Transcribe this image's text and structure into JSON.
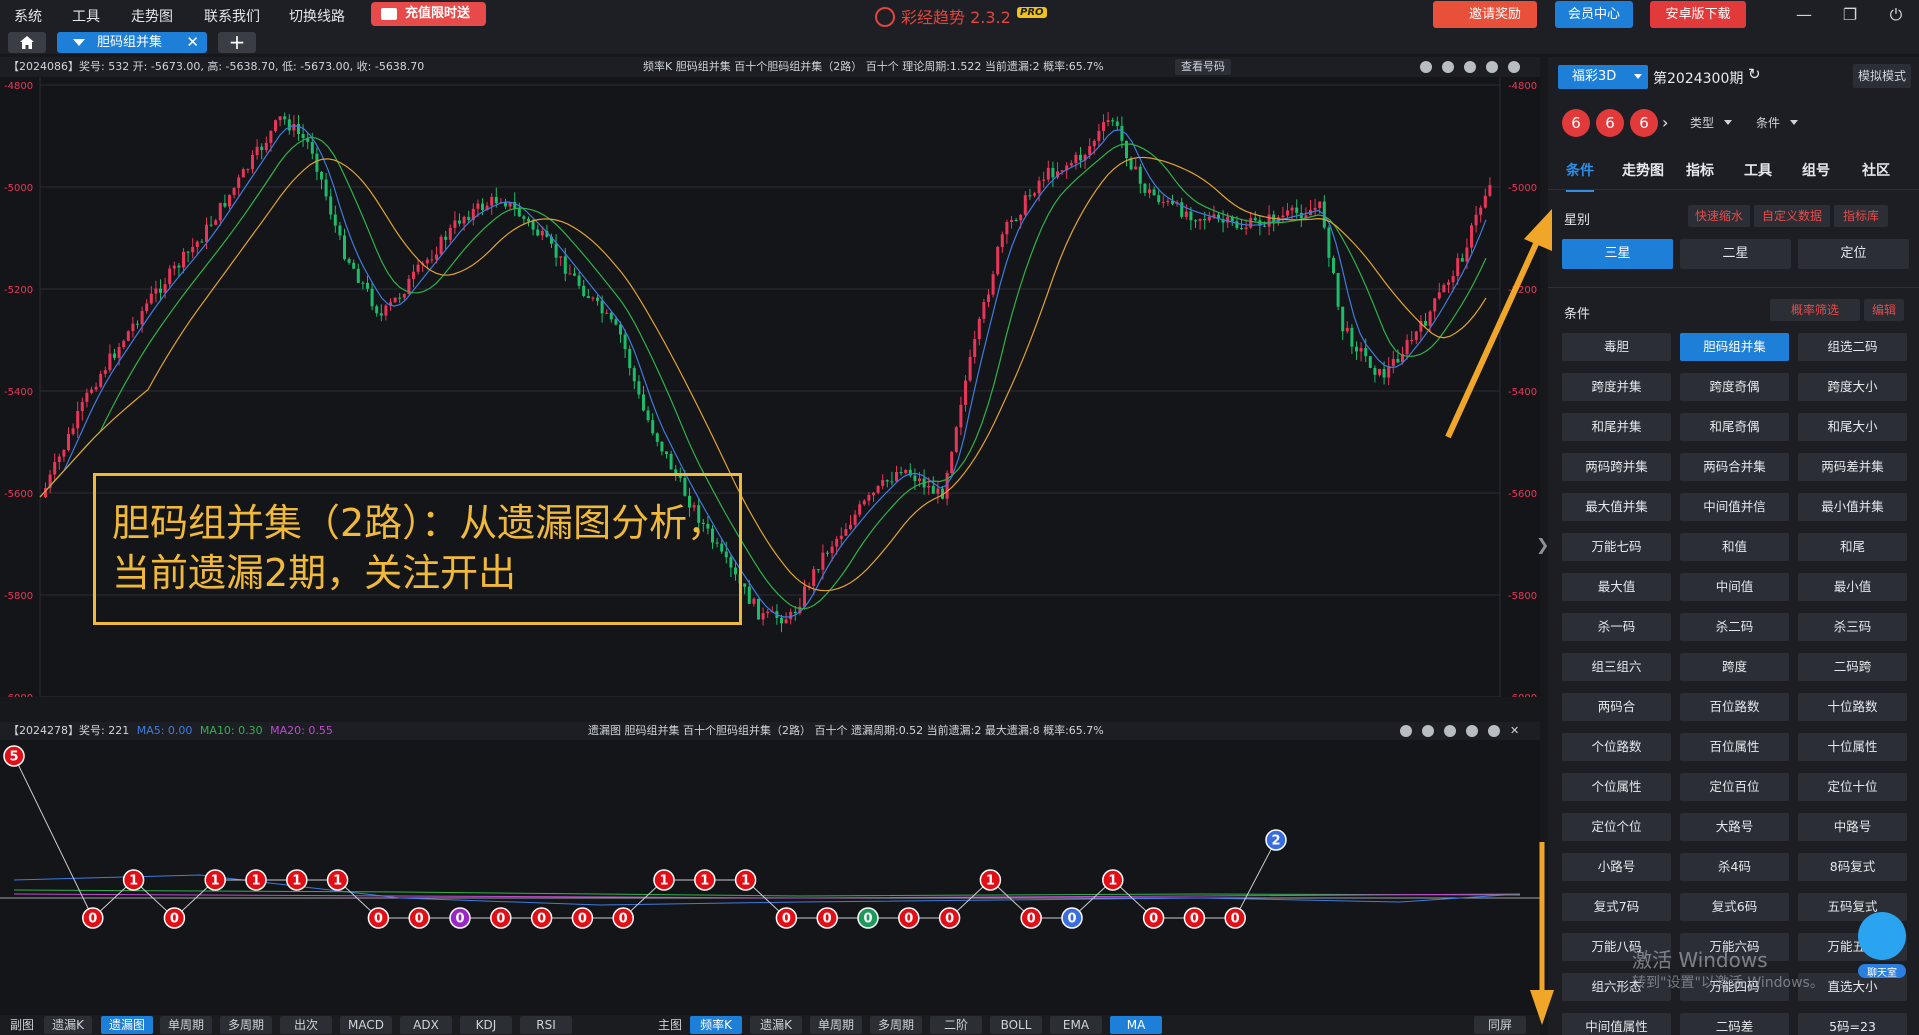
{
  "menu": [
    "系统",
    "工具",
    "走势图",
    "联系我们",
    "切换线路"
  ],
  "promo_label": "充值限时送",
  "app_title": "彩经趋势 2.3.2",
  "pro_badge": "PRO",
  "header_buttons": {
    "invite": "邀请奖励",
    "member": "会员中心",
    "android": "安卓版下载"
  },
  "tab": {
    "label": "胆码组并集",
    "close": "✕",
    "add": "+"
  },
  "main_chart": {
    "info": "【2024086】奖号: 532  开: -5673.00, 高: -5638.70, 低: -5673.00, 收: -5638.70",
    "center": "频率K  胆码组并集  百十个胆码组并集（2路）  百十个  理论周期:1.522  当前遗漏:2  概率:65.7%",
    "button": "查看号码"
  },
  "lower_chart": {
    "info_prefix": "【2024278】奖号: 221",
    "ma5": "MA5: 0.00",
    "ma10": "MA10: 0.30",
    "ma20": "MA20: 0.55",
    "center": "遗漏图  胆码组并集  百十个胆码组并集（2路）  百十个  遗漏周期:0.52  当前遗漏:2  最大遗漏:8  概率:65.7%"
  },
  "annotation": {
    "line1": "胆码组并集（2路）：从遗漏图分析，",
    "line2": "当前遗漏2期，关注开出"
  },
  "bottom_left": [
    "副图",
    "遗漏K",
    "遗漏图",
    "单周期",
    "多周期",
    "出次",
    "MACD",
    "ADX",
    "KDJ",
    "RSI"
  ],
  "bottom_right": [
    "主图",
    "频率K",
    "遗漏K",
    "单周期",
    "多周期",
    "二阶",
    "BOLL",
    "EMA",
    "MA"
  ],
  "bottom_end": "同屏",
  "sidebar": {
    "lottery": "福彩3D",
    "period": "第2024300期",
    "mode": "模拟模式",
    "balls": [
      "6",
      "6",
      "6"
    ],
    "type_label": "类型",
    "cond_label": "条件",
    "nav": [
      "条件",
      "走势图",
      "指标",
      "工具",
      "组号",
      "社区"
    ],
    "star_label": "星别",
    "quick_tags": [
      "快速缩水",
      "自定义数据",
      "指标库"
    ],
    "star_buttons": [
      "三星",
      "二星",
      "定位"
    ],
    "cond_section": "条件",
    "filter": "概率筛选",
    "edit": "编辑",
    "conditions": [
      "毒胆",
      "胆码组并集",
      "组选二码",
      "跨度并集",
      "跨度奇偶",
      "跨度大小",
      "和尾并集",
      "和尾奇偶",
      "和尾大小",
      "两码跨并集",
      "两码合并集",
      "两码差并集",
      "最大值并集",
      "中间值并信",
      "最小值并集",
      "万能七码",
      "和值",
      "和尾",
      "最大值",
      "中间值",
      "最小值",
      "杀一码",
      "杀二码",
      "杀三码",
      "组三组六",
      "跨度",
      "二码跨",
      "两码合",
      "百位路数",
      "十位路数",
      "个位路数",
      "百位属性",
      "十位属性",
      "个位属性",
      "定位百位",
      "定位十位",
      "定位个位",
      "大路号",
      "中路号",
      "小路号",
      "杀4码",
      "8码复式",
      "复式7码",
      "复式6码",
      "五码复式",
      "万能八码",
      "万能六码",
      "万能五码",
      "组六形态",
      "万能四码",
      "直选大小",
      "中间值属性",
      "二码差",
      "5码=23"
    ]
  },
  "watermark": {
    "line1": "激活 Windows",
    "line2": "转到\"设置\"以激活 Windows。"
  },
  "chat_label": "聊天室",
  "y_ticks": [
    "-4800",
    "-5000",
    "-5200",
    "-5400",
    "-5600",
    "-5800",
    "-6000"
  ],
  "omission_axis_top": "5",
  "omission_series": [
    5,
    0,
    1,
    0,
    1,
    1,
    1,
    1,
    0,
    0,
    0,
    0,
    0,
    0,
    0,
    1,
    1,
    1,
    0,
    0,
    0,
    0,
    0,
    1,
    0,
    0,
    1,
    0,
    0,
    0,
    2
  ],
  "colors": {
    "up": "#e8365a",
    "down": "#1dbb6a",
    "ma5": "#3f7ce0",
    "ma10": "#2fb24a",
    "ma20": "#e0a331",
    "accent": "#1e7fd8",
    "annotation": "#f0b93a"
  }
}
